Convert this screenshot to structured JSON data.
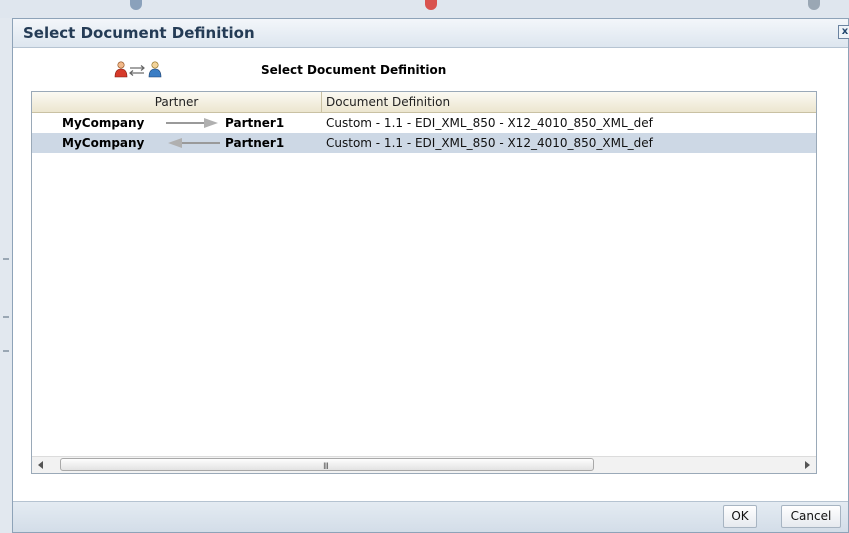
{
  "dialog": {
    "title": "Select Document Definition",
    "close_symbol": "x"
  },
  "header": {
    "icon": "partner-exchange-icon",
    "title": "Select Document Definition"
  },
  "table": {
    "columns": [
      "Partner",
      "Document Definition"
    ],
    "rows": [
      {
        "from": "MyCompany",
        "direction": "right-arrow",
        "to": "Partner1",
        "definition": "Custom - 1.1 - EDI_XML_850 - X12_4010_850_XML_def",
        "selected": false
      },
      {
        "from": "MyCompany",
        "direction": "left-arrow",
        "to": "Partner1",
        "definition": "Custom - 1.1 - EDI_XML_850 - X12_4010_850_XML_def",
        "selected": true
      }
    ]
  },
  "scrollbar": {
    "grip": "III"
  },
  "footer": {
    "ok_label": "OK",
    "cancel_label": "Cancel"
  },
  "colors": {
    "selected_row": "#cdd8e5",
    "title_text": "#243b55",
    "header_bg": "#ece6cf"
  }
}
